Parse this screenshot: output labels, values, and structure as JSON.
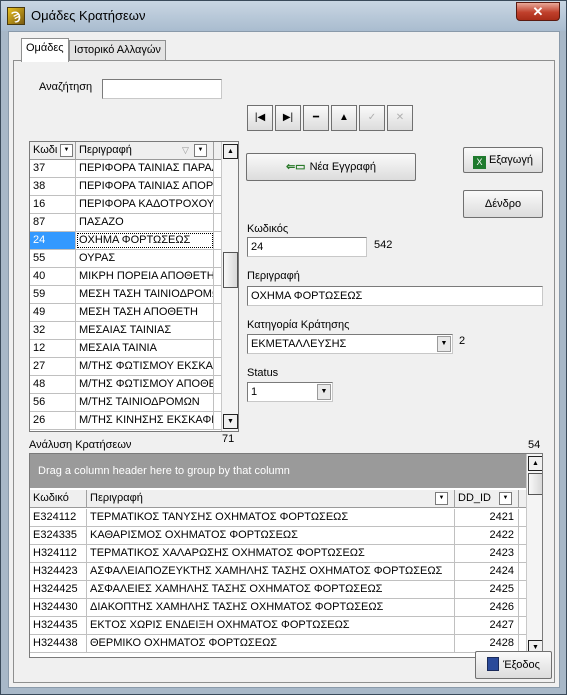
{
  "window": {
    "title": "Ομάδες Κρατήσεων",
    "icon": "app-logo-icon",
    "close": "✕"
  },
  "tabs": [
    {
      "label": "Ομάδες",
      "active": true
    },
    {
      "label": "Ιστορικό Αλλαγών",
      "active": false
    }
  ],
  "search": {
    "label": "Αναζήτηση",
    "value": ""
  },
  "navigator": [
    {
      "icon": "first-record-icon",
      "glyph": "|◀",
      "enabled": true
    },
    {
      "icon": "last-record-icon",
      "glyph": "▶|",
      "enabled": true
    },
    {
      "icon": "delete-record-icon",
      "glyph": "━",
      "enabled": true
    },
    {
      "icon": "edit-record-icon",
      "glyph": "▲",
      "enabled": true
    },
    {
      "icon": "post-record-icon",
      "glyph": "✓",
      "enabled": false
    },
    {
      "icon": "cancel-edit-icon",
      "glyph": "✕",
      "enabled": false
    }
  ],
  "left_grid": {
    "columns": [
      "Κωδι",
      "Περιγραφή"
    ],
    "rows": [
      {
        "code": "37",
        "desc": "ΠΕΡΙΦΟΡΑ ΤΑΙΝΙΑΣ ΠΑΡΑΛ"
      },
      {
        "code": "38",
        "desc": "ΠΕΡΙΦΟΡΑ ΤΑΙΝΙΑΣ ΑΠΟΡΡ"
      },
      {
        "code": "16",
        "desc": "ΠΕΡΙΦΟΡΑ ΚΑΔΟΤΡΟΧΟΥ"
      },
      {
        "code": "87",
        "desc": "ΠΑΣΑΖΟ"
      },
      {
        "code": "24",
        "desc": "ΟΧΗΜΑ ΦΟΡΤΩΣΕΩΣ",
        "selected": true
      },
      {
        "code": "55",
        "desc": "ΟΥΡΑΣ"
      },
      {
        "code": "40",
        "desc": "ΜΙΚΡΗ ΠΟΡΕΙΑ ΑΠΟΘΕΤΗ"
      },
      {
        "code": "59",
        "desc": "ΜΕΣΗ ΤΑΣΗ ΤΑΙΝΙΟΔΡΟΜΩ"
      },
      {
        "code": "49",
        "desc": "ΜΕΣΗ ΤΑΣΗ ΑΠΟΘΕΤΗ"
      },
      {
        "code": "32",
        "desc": "ΜΕΣΑΙΑΣ ΤΑΙΝΙΑΣ"
      },
      {
        "code": "12",
        "desc": "ΜΕΣΑΙΑ ΤΑΙΝΙΑ"
      },
      {
        "code": "27",
        "desc": "Μ/ΤΗΣ ΦΩΤΙΣΜΟΥ ΕΚΣΚΑ"
      },
      {
        "code": "48",
        "desc": "Μ/ΤΗΣ ΦΩΤΙΣΜΟΥ ΑΠΟΘΕ"
      },
      {
        "code": "56",
        "desc": "Μ/ΤΗΣ ΤΑΙΝΙΟΔΡΟΜΩΝ"
      },
      {
        "code": "26",
        "desc": "Μ/ΤΗΣ ΚΙΝΗΣΗΣ ΕΚΣΚΑΦΕ"
      }
    ],
    "count": "71",
    "scroll_position": 0.42
  },
  "buttons": {
    "new_record": "Νέα Εγγραφή",
    "export": "Εξαγωγή",
    "tree": "Δένδρο",
    "exit": "Έξοδος"
  },
  "form": {
    "code_label": "Κωδικός",
    "code_value": "24",
    "code_extra": "542",
    "desc_label": "Περιγραφή",
    "desc_value": "ΟΧΗΜΑ ΦΟΡΤΩΣΕΩΣ",
    "category_label": "Κατηγορία Κράτησης",
    "category_value": "ΕΚΜΕΤΑΛΛΕΥΣΗΣ",
    "category_extra": "2",
    "status_label": "Status",
    "status_value": "1"
  },
  "analysis": {
    "label": "Ανάλυση Κρατήσεων",
    "count": "54",
    "group_hint": "Drag a column header here to group by that column",
    "columns": [
      "Κωδικό",
      "Περιγραφή",
      "DD_ID"
    ],
    "rows": [
      {
        "code": "E324112",
        "desc": "ΤΕΡΜΑΤΙΚΟΣ ΤΑΝΥΣΗΣ ΟΧΗΜΑΤΟΣ ΦΟΡΤΩΣΕΩΣ",
        "id": "2421"
      },
      {
        "code": "E324335",
        "desc": "ΚΑΘΑΡΙΣΜΟΣ ΟΧΗΜΑΤΟΣ ΦΟΡΤΩΣΕΩΣ",
        "id": "2422"
      },
      {
        "code": "H324112",
        "desc": "ΤΕΡΜΑΤΙΚΟΣ ΧΑΛΑΡΩΣΗΣ ΟΧΗΜΑΤΟΣ ΦΟΡΤΩΣΕΩΣ",
        "id": "2423"
      },
      {
        "code": "H324423",
        "desc": "ΑΣΦΑΛΕΙΑΠΟΖΕΥΚΤΗΣ ΧΑΜΗΛΗΣ ΤΑΣΗΣ ΟΧΗΜΑΤΟΣ ΦΟΡΤΩΣΕΩΣ",
        "id": "2424"
      },
      {
        "code": "H324425",
        "desc": "ΑΣΦΑΛΕΙΕΣ ΧΑΜΗΛΗΣ ΤΑΣΗΣ ΟΧΗΜΑΤΟΣ ΦΟΡΤΩΣΕΩΣ",
        "id": "2425"
      },
      {
        "code": "H324430",
        "desc": "ΔΙΑΚΟΠΤΗΣ ΧΑΜΗΛΗΣ ΤΑΣΗΣ ΟΧΗΜΑΤΟΣ ΦΟΡΤΩΣΕΩΣ",
        "id": "2426"
      },
      {
        "code": "H324435",
        "desc": "ΕΚΤΟΣ ΧΩΡΙΣ ΕΝΔΕΙΞΗ ΟΧΗΜΑΤΟΣ ΦΟΡΤΩΣΕΩΣ",
        "id": "2427"
      },
      {
        "code": "H324438",
        "desc": "ΘΕΡΜΙΚΟ ΟΧΗΜΑΤΟΣ ΦΟΡΤΩΣΕΩΣ",
        "id": "2428"
      }
    ],
    "scroll_position": 0.0
  },
  "colors": {
    "selection": "#3399ff",
    "window_frame": "#a8b8c8",
    "group_bar": "#9a9a9a"
  }
}
